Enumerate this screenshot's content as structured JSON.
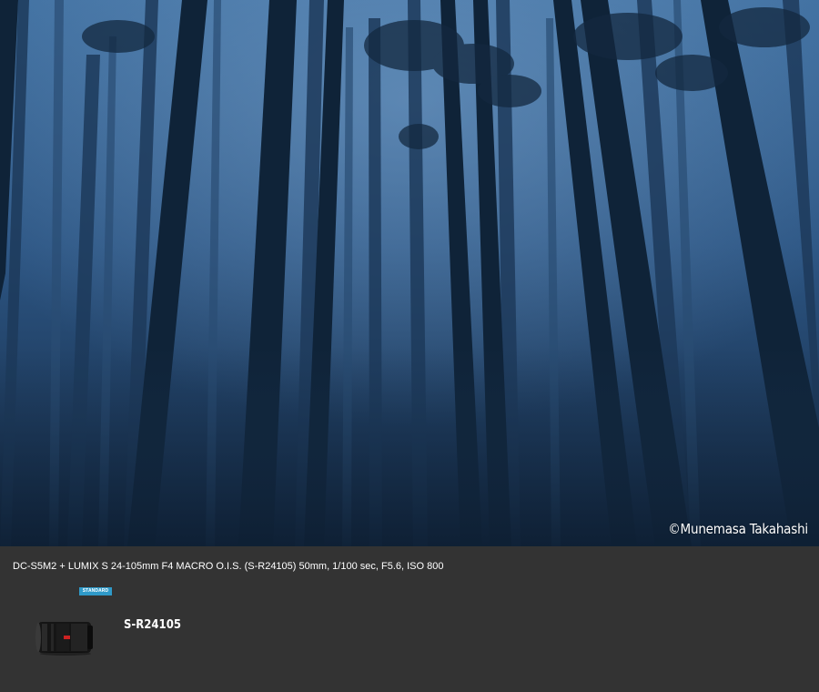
{
  "photo": {
    "alt": "Misty blue forest of tall cedar trees",
    "credit": "©Munemasa Takahashi"
  },
  "caption": "DC-S5M2 + LUMIX S 24-105mm F4 MACRO O.I.S. (S-R24105) 50mm, 1/100 sec, F5.6, ISO 800",
  "lens": {
    "badge": "STANDARD",
    "model": "S-R24105"
  },
  "colors": {
    "background": "#333333",
    "badge": "#2f9ac9",
    "text": "#ffffff"
  }
}
